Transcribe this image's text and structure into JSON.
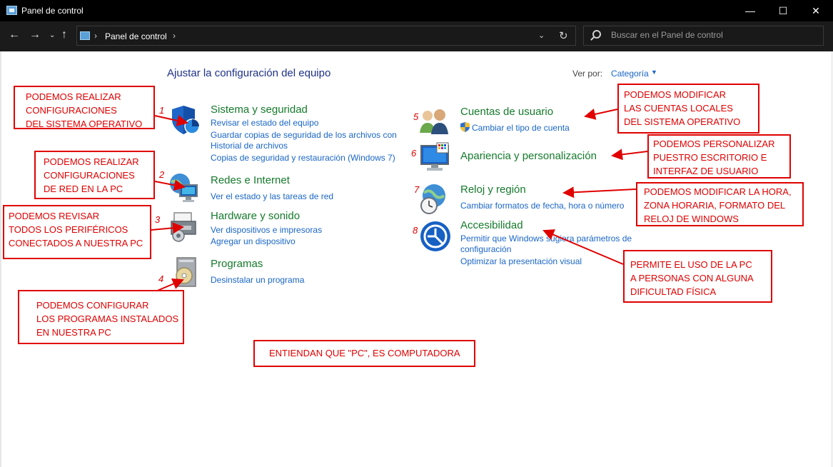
{
  "window": {
    "title": "Panel de control",
    "minimize": "—",
    "maximize": "☐",
    "close": "✕"
  },
  "address": {
    "breadcrumb": "Panel de control",
    "search_placeholder": "Buscar en el Panel de control"
  },
  "main": {
    "heading": "Ajustar la configuración del equipo",
    "view_by_label": "Ver por:",
    "view_by_value": "Categoría"
  },
  "categories": [
    {
      "title": "Sistema y seguridad",
      "links": [
        "Revisar el estado del equipo",
        "Guardar copias de seguridad de los archivos con",
        "Historial de archivos",
        "Copias de seguridad y restauración (Windows 7)"
      ]
    },
    {
      "title": "Redes e Internet",
      "links": [
        "Ver el estado y las tareas de red"
      ]
    },
    {
      "title": "Hardware y sonido",
      "links": [
        "Ver dispositivos e impresoras",
        "Agregar un dispositivo"
      ]
    },
    {
      "title": "Programas",
      "links": [
        "Desinstalar un programa"
      ]
    },
    {
      "title": "Cuentas de usuario",
      "links": [
        "Cambiar el tipo de cuenta"
      ]
    },
    {
      "title": "Apariencia y personalización",
      "links": []
    },
    {
      "title": "Reloj y región",
      "links": [
        "Cambiar formatos de fecha, hora o número"
      ]
    },
    {
      "title": "Accesibilidad",
      "links": [
        "Permitir que Windows sugiera parámetros de",
        "configuración",
        "Optimizar la presentación visual"
      ]
    }
  ],
  "numbers": [
    "1",
    "2",
    "3",
    "4",
    "5",
    "6",
    "7",
    "8"
  ],
  "annotations": [
    {
      "lines": [
        "PODEMOS REALIZAR",
        "CONFIGURACIONES",
        "DEL SISTEMA OPERATIVO"
      ]
    },
    {
      "lines": [
        "PODEMOS REALIZAR",
        "CONFIGURACIONES",
        "DE RED EN LA PC"
      ]
    },
    {
      "lines": [
        "PODEMOS REVISAR",
        "TODOS LOS PERIFÉRICOS",
        "CONECTADOS A NUESTRA PC"
      ]
    },
    {
      "lines": [
        "PODEMOS CONFIGURAR",
        "LOS PROGRAMAS INSTALADOS",
        "EN NUESTRA PC"
      ]
    },
    {
      "lines": [
        "PODEMOS MODIFICAR",
        "LAS CUENTAS LOCALES",
        "DEL SISTEMA OPERATIVO"
      ]
    },
    {
      "lines": [
        "PODEMOS PERSONALIZAR",
        "PUESTRO ESCRITORIO E",
        "INTERFAZ DE USUARIO"
      ]
    },
    {
      "lines": [
        "PODEMOS MODIFICAR LA HORA,",
        "ZONA HORARIA, FORMATO DEL",
        "RELOJ DE WINDOWS"
      ]
    },
    {
      "lines": [
        "PERMITE EL USO DE LA PC",
        "A PERSONAS CON ALGUNA",
        "DIFICULTAD FÍSICA"
      ]
    },
    {
      "lines": [
        "ENTIENDAN QUE \"PC\", ES COMPUTADORA"
      ]
    }
  ],
  "colors": {
    "annotation": "#e00000",
    "category_title": "#157a2c",
    "link": "#1a66c8",
    "heading": "#1e3287"
  }
}
